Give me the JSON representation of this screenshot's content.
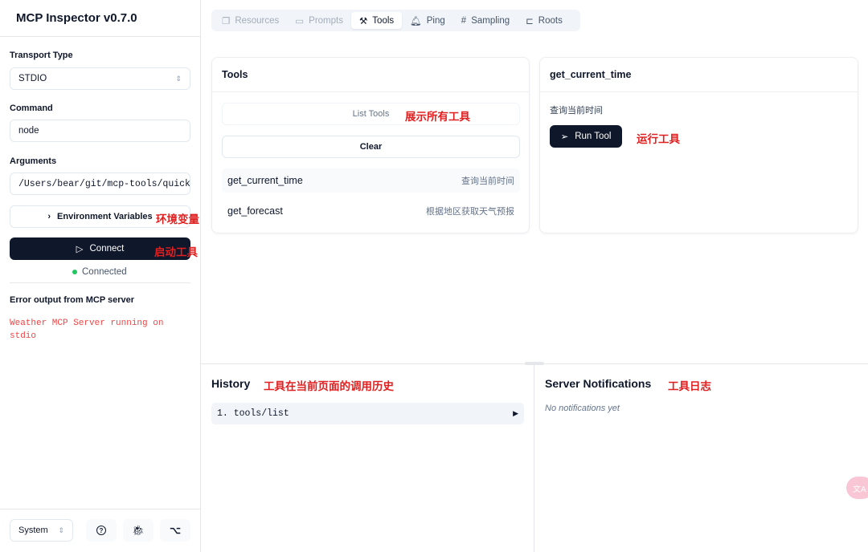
{
  "app": {
    "title": "MCP Inspector v0.7.0"
  },
  "sidebar": {
    "transport_label": "Transport Type",
    "transport_value": "STDIO",
    "command_label": "Command",
    "command_value": "node",
    "arguments_label": "Arguments",
    "arguments_value": "/Users/bear/git/mcp-tools/quick",
    "env_label": "Environment Variables",
    "connect_label": "Connect",
    "status": "Connected",
    "status_color": "#22c55e",
    "error_label": "Error output from MCP server",
    "error_text": "Weather MCP Server running on stdio",
    "theme_value": "System"
  },
  "tabs": [
    {
      "label": "Resources",
      "icon": "file-copy-icon"
    },
    {
      "label": "Prompts",
      "icon": "message-icon"
    },
    {
      "label": "Tools",
      "icon": "hammer-icon"
    },
    {
      "label": "Ping",
      "icon": "bell-icon"
    },
    {
      "label": "Sampling",
      "icon": "hash-icon"
    },
    {
      "label": "Roots",
      "icon": "folder-tree-icon"
    }
  ],
  "tools": {
    "title": "Tools",
    "list_label": "List Tools",
    "clear_label": "Clear",
    "items": [
      {
        "name": "get_current_time",
        "desc": "查询当前时间"
      },
      {
        "name": "get_forecast",
        "desc": "根据地区获取天气预报"
      }
    ]
  },
  "detail": {
    "title": "get_current_time",
    "desc": "查询当前时间",
    "run_label": "Run Tool"
  },
  "history": {
    "title": "History",
    "items": [
      {
        "label": "1. tools/list"
      }
    ]
  },
  "notifications": {
    "title": "Server Notifications",
    "empty": "No notifications yet"
  },
  "annotations": {
    "list": "展示所有工具",
    "run": "运行工具",
    "env": "环境变量",
    "connect": "启动工具",
    "history": "工具在当前页面的调用历史",
    "notif": "工具日志"
  },
  "accent": "#0f172a",
  "annotation_color": "#e02020"
}
